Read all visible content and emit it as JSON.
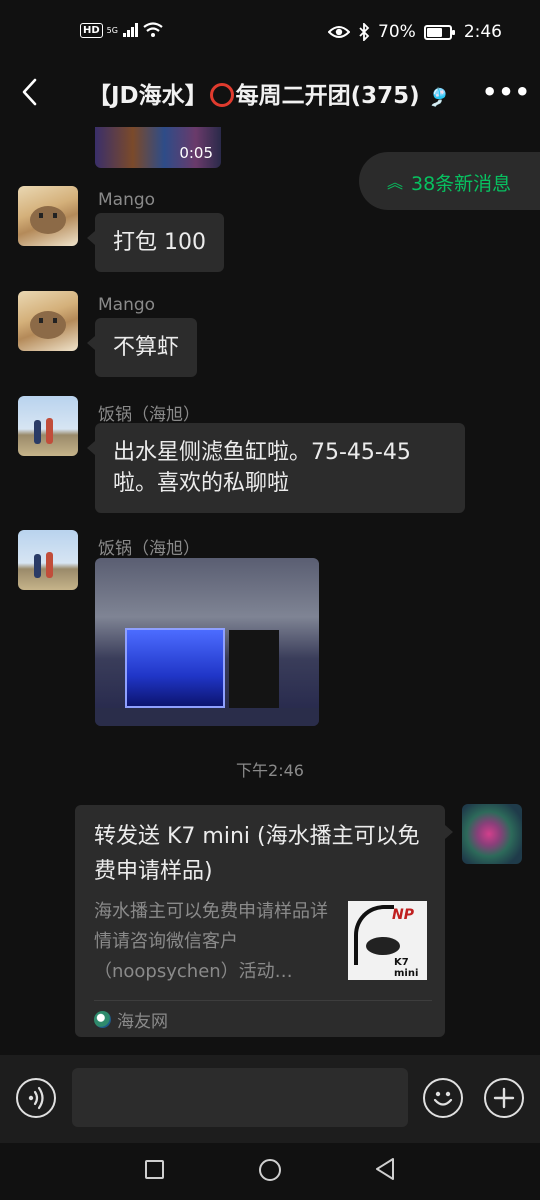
{
  "status_bar": {
    "hd": "HD",
    "network": "5G",
    "battery_percent": "70%",
    "battery_level": 0.7,
    "time": "2:46"
  },
  "header": {
    "title_prefix": "【JD海水】",
    "title_suffix": "每周二开团(375)",
    "title_trailing": "🎐",
    "more_label": "•••"
  },
  "chat": {
    "video": {
      "duration": "0:05"
    },
    "new_messages": {
      "label": "38条新消息",
      "arrow": "︽"
    },
    "messages": [
      {
        "sender": "Mango",
        "text": "打包 100"
      },
      {
        "sender": "Mango",
        "text": "不算虾"
      },
      {
        "sender": "饭锅（海旭）",
        "text": "出水星侧滤鱼缸啦。75-45-45啦。喜欢的私聊啦"
      },
      {
        "sender": "饭锅（海旭）",
        "image": "aquarium-photo"
      }
    ],
    "timestamp": "下午2:46",
    "shared_card": {
      "title": "转发送 K7 mini (海水播主可以免费申请样品)",
      "description": "海水播主可以免费申请样品详情请咨询微信客户（noopsychen）活动…",
      "thumb_brand": "NP",
      "thumb_model": "K7 mini",
      "source": "海友网"
    }
  },
  "input_bar": {
    "placeholder": ""
  },
  "colors": {
    "accent_green": "#07c160",
    "bubble": "#2c2c2c",
    "background": "#111111"
  }
}
